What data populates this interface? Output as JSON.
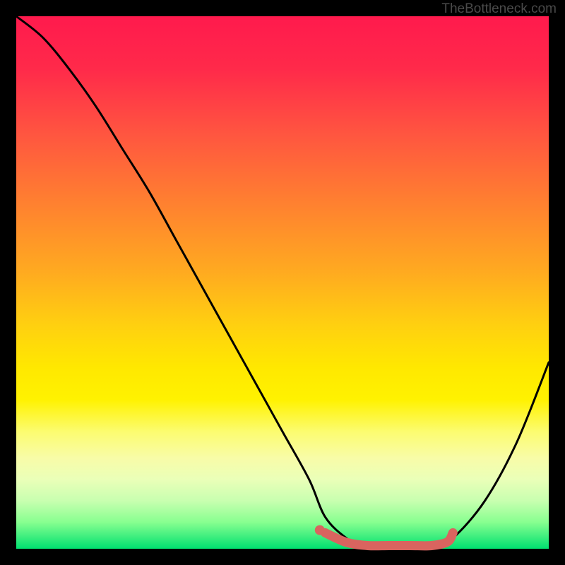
{
  "watermark": "TheBottleneck.com",
  "chart_data": {
    "type": "line",
    "title": "",
    "xlabel": "",
    "ylabel": "",
    "xlim": [
      0,
      100
    ],
    "ylim": [
      0,
      100
    ],
    "series": [
      {
        "name": "bottleneck-curve",
        "x": [
          0,
          5,
          10,
          15,
          20,
          25,
          30,
          35,
          40,
          45,
          50,
          55,
          58,
          62,
          66,
          70,
          74,
          78,
          82,
          88,
          94,
          100
        ],
        "values": [
          100,
          96,
          90,
          83,
          75,
          67,
          58,
          49,
          40,
          31,
          22,
          13,
          6,
          2,
          0,
          0,
          0,
          0,
          2,
          9,
          20,
          35
        ]
      },
      {
        "name": "highlight-segment",
        "x": [
          58,
          62,
          66,
          70,
          74,
          78,
          81,
          82
        ],
        "values": [
          3,
          1.2,
          0.6,
          0.6,
          0.6,
          0.6,
          1.3,
          3
        ]
      }
    ],
    "marker": {
      "x": 57,
      "y": 3.5
    },
    "gradient_stops": [
      {
        "pct": 0,
        "color": "#ff1a4d"
      },
      {
        "pct": 50,
        "color": "#ffd400"
      },
      {
        "pct": 100,
        "color": "#00e070"
      }
    ]
  }
}
